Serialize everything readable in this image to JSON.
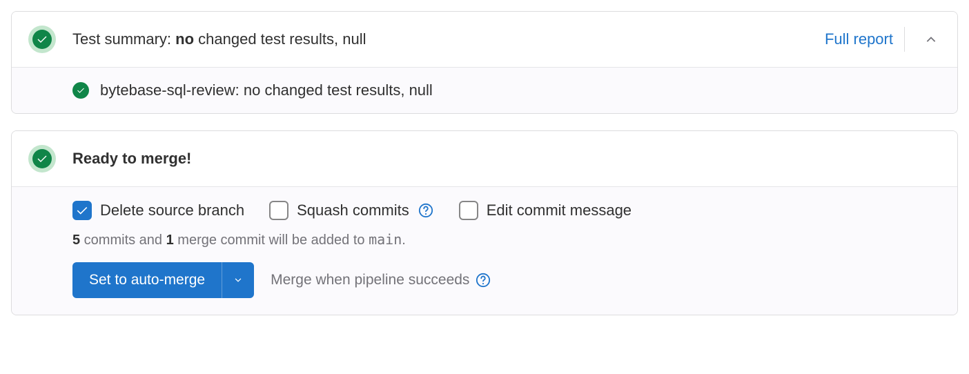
{
  "test_summary": {
    "prefix": "Test summary: ",
    "emphasis": "no",
    "suffix": " changed test results, null",
    "full_report_label": "Full report",
    "sub_item": "bytebase-sql-review: no changed test results, null"
  },
  "merge": {
    "ready_title": "Ready to merge!",
    "options": {
      "delete_branch": "Delete source branch",
      "squash": "Squash commits",
      "edit_commit": "Edit commit message"
    },
    "commits_info": {
      "count": "5",
      "text1": " commits and ",
      "merge_count": "1",
      "text2": " merge commit will be added to ",
      "branch": "main",
      "suffix": "."
    },
    "button_label": "Set to auto-merge",
    "hint": "Merge when pipeline succeeds"
  }
}
